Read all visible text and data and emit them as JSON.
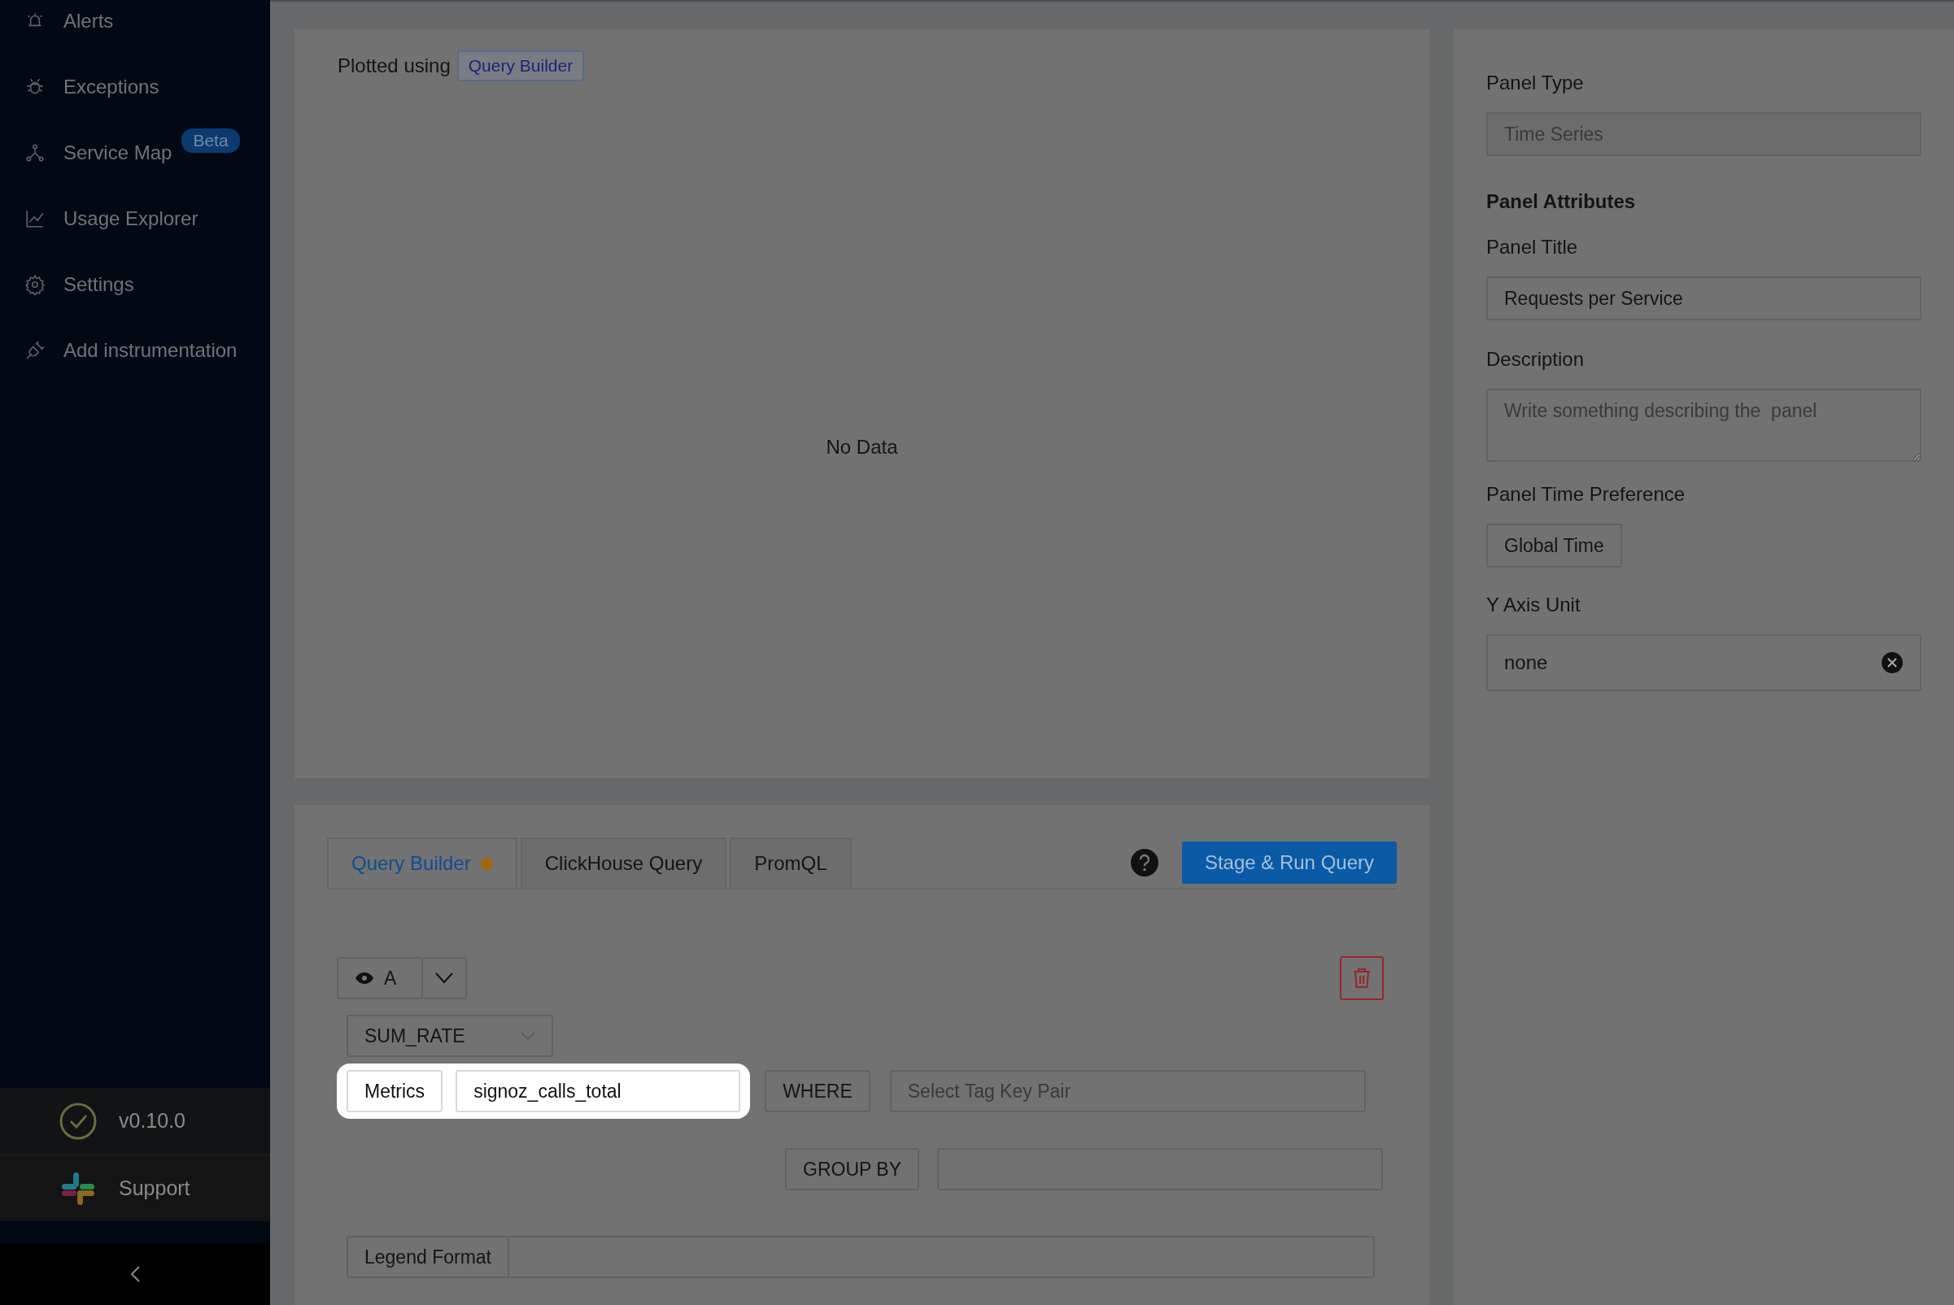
{
  "sidebar": {
    "items": [
      {
        "label": "Alerts",
        "kind": "alarm"
      },
      {
        "label": "Exceptions",
        "kind": "bug"
      },
      {
        "label": "Service Map",
        "kind": "graph",
        "badge": "Beta"
      },
      {
        "label": "Usage Explorer",
        "kind": "chart"
      },
      {
        "label": "Settings",
        "kind": "gear"
      },
      {
        "label": "Add instrumentation",
        "kind": "plug"
      }
    ],
    "version": "v0.10.0",
    "support": "Support"
  },
  "chart": {
    "plotted_label": "Plotted using",
    "plotted_badge": "Query Builder",
    "empty_text": "No Data"
  },
  "query": {
    "tabs": [
      {
        "label": "Query Builder",
        "selected": true,
        "modified": true
      },
      {
        "label": "ClickHouse Query",
        "selected": false,
        "modified": false
      },
      {
        "label": "PromQL",
        "selected": false,
        "modified": false
      }
    ],
    "run_button": "Stage & Run Query",
    "query_name": "A",
    "aggregate": "SUM_RATE",
    "metrics_label": "Metrics",
    "metrics_value": "signoz_calls_total",
    "metrics_highlighted": true,
    "where_label": "WHERE",
    "where_placeholder": "Select Tag Key Pair",
    "group_by_label": "GROUP BY",
    "legend_label": "Legend Format"
  },
  "panel": {
    "type_label": "Panel Type",
    "type_value": "Time Series",
    "type_disabled": true,
    "attributes_heading": "Panel Attributes",
    "title_label": "Panel Title",
    "title_value": "Requests per Service",
    "description_label": "Description",
    "description_placeholder": "Write something describing the  panel",
    "time_label": "Panel Time Preference",
    "time_value": "Global Time",
    "unit_label": "Y Axis Unit",
    "unit_value": "none"
  }
}
